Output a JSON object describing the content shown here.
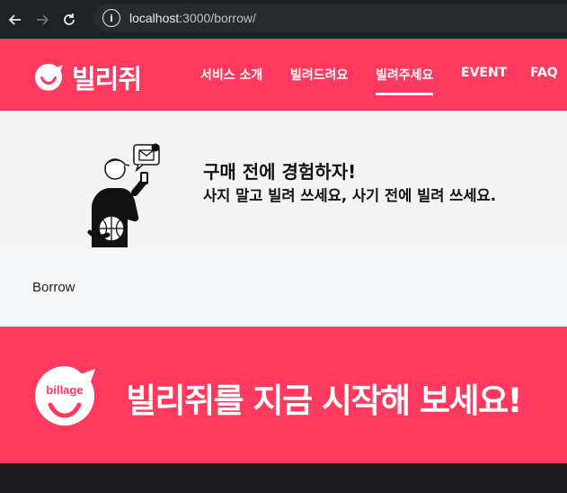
{
  "browser": {
    "url_host": "localhost",
    "url_rest": ":3000/borrow/",
    "back_icon": "arrow-left-icon",
    "forward_icon": "arrow-right-icon",
    "reload_icon": "reload-icon",
    "info_icon": "info-icon",
    "info_glyph": "i"
  },
  "header": {
    "brand": "빌리쥐",
    "menu": [
      "서비스 소개",
      "빌려드려요",
      "빌려주세요",
      "EVENT",
      "FAQ"
    ],
    "active_menu": "빌려주세요",
    "bg_color": "#ff3a5e"
  },
  "hero": {
    "title": "구매 전에 경험하자!",
    "subtitle": "사지 말고 빌려 쓰세요, 사기 전에 빌려 쓰세요."
  },
  "content": {
    "text": "Borrow"
  },
  "cta": {
    "badge_text": "billage",
    "text": "빌리쥐를 지금 시작해 보세요!"
  }
}
